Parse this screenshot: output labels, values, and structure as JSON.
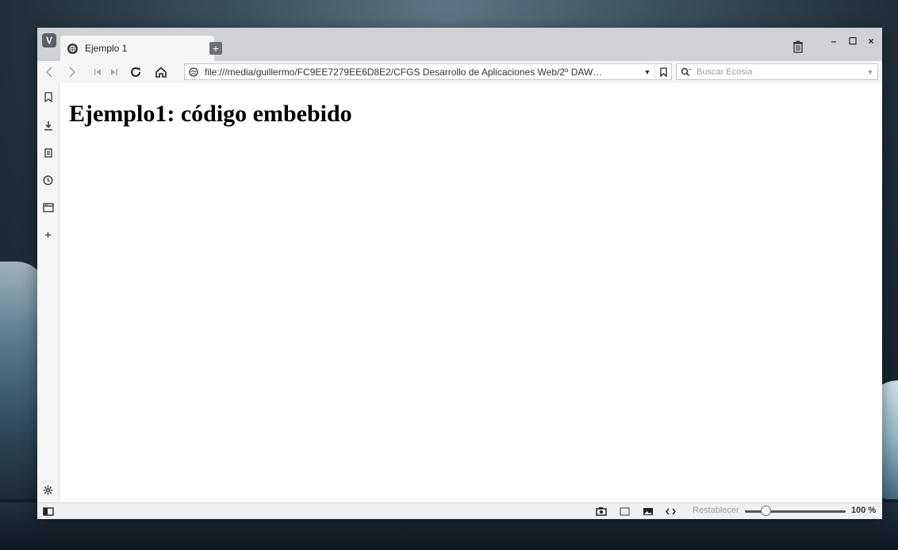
{
  "browser": {
    "tab": {
      "title": "Ejemplo 1",
      "favicon": "globe-icon"
    },
    "window_controls": [
      "–",
      "☐",
      "×"
    ]
  },
  "toolbar": {
    "url": "file:///media/guillermo/FC9EE7279EE6D8E2/CFGS Desarrollo de Aplicaciones Web/2º DAW…",
    "search_placeholder": "Buscar Ecosia"
  },
  "page": {
    "heading": "Ejemplo1: código embebido"
  },
  "statusbar": {
    "reset_label": "Restablecer",
    "zoom": "100 %"
  },
  "colors": {
    "tabbar": "#cfd1d4",
    "toolbar": "#f5f5f5",
    "page": "#ffffff"
  }
}
